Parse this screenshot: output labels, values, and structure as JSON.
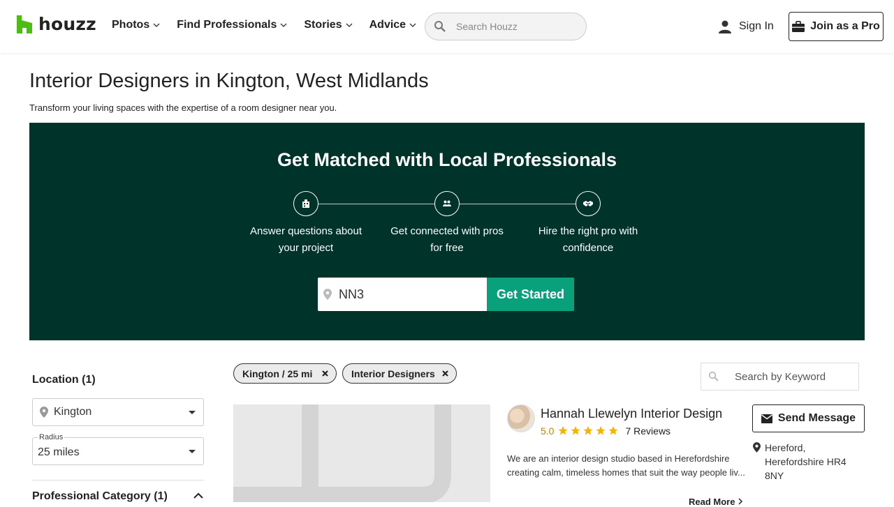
{
  "header": {
    "logo_text": "houzz",
    "nav": [
      {
        "label": "Photos"
      },
      {
        "label": "Find Professionals"
      },
      {
        "label": "Stories"
      },
      {
        "label": "Advice"
      }
    ],
    "search_placeholder": "Search Houzz",
    "sign_in": "Sign In",
    "join_pro": "Join as a Pro"
  },
  "page": {
    "title": "Interior Designers in Kington, West Midlands",
    "subtitle": "Transform your living spaces with the expertise of a room designer near you."
  },
  "banner": {
    "heading": "Get Matched with Local Professionals",
    "steps": [
      {
        "icon": "questionnaire-icon",
        "text": "Answer questions about your project"
      },
      {
        "icon": "people-icon",
        "text": "Get connected with pros for free"
      },
      {
        "icon": "handshake-icon",
        "text": "Hire the right pro with confidence"
      }
    ],
    "zip_value": "NN3",
    "cta": "Get Started"
  },
  "sidebar": {
    "location_heading": "Location (1)",
    "location_value": "Kington",
    "radius_label": "Radius",
    "radius_value": "25 miles",
    "category_heading": "Professional Category (1)"
  },
  "filters": {
    "chips": [
      {
        "label": "Kington / 25 mi"
      },
      {
        "label": "Interior Designers"
      }
    ],
    "keyword_placeholder": "Search by Keyword"
  },
  "result": {
    "name": "Hannah Llewelyn Interior Design",
    "rating": "5.0",
    "stars": 5,
    "reviews": "7 Reviews",
    "description": "We are an interior design studio based in Herefordshire creating calm, timeless homes that suit the way people liv...",
    "read_more": "Read More",
    "send_message": "Send Message",
    "address_lines": [
      "Hereford,",
      "Herefordshire HR4",
      "8NY"
    ]
  },
  "colors": {
    "brand_green": "#4dbc15",
    "banner_bg": "#00332a",
    "cta_green": "#09a17c",
    "star_gold": "#f6b400"
  }
}
